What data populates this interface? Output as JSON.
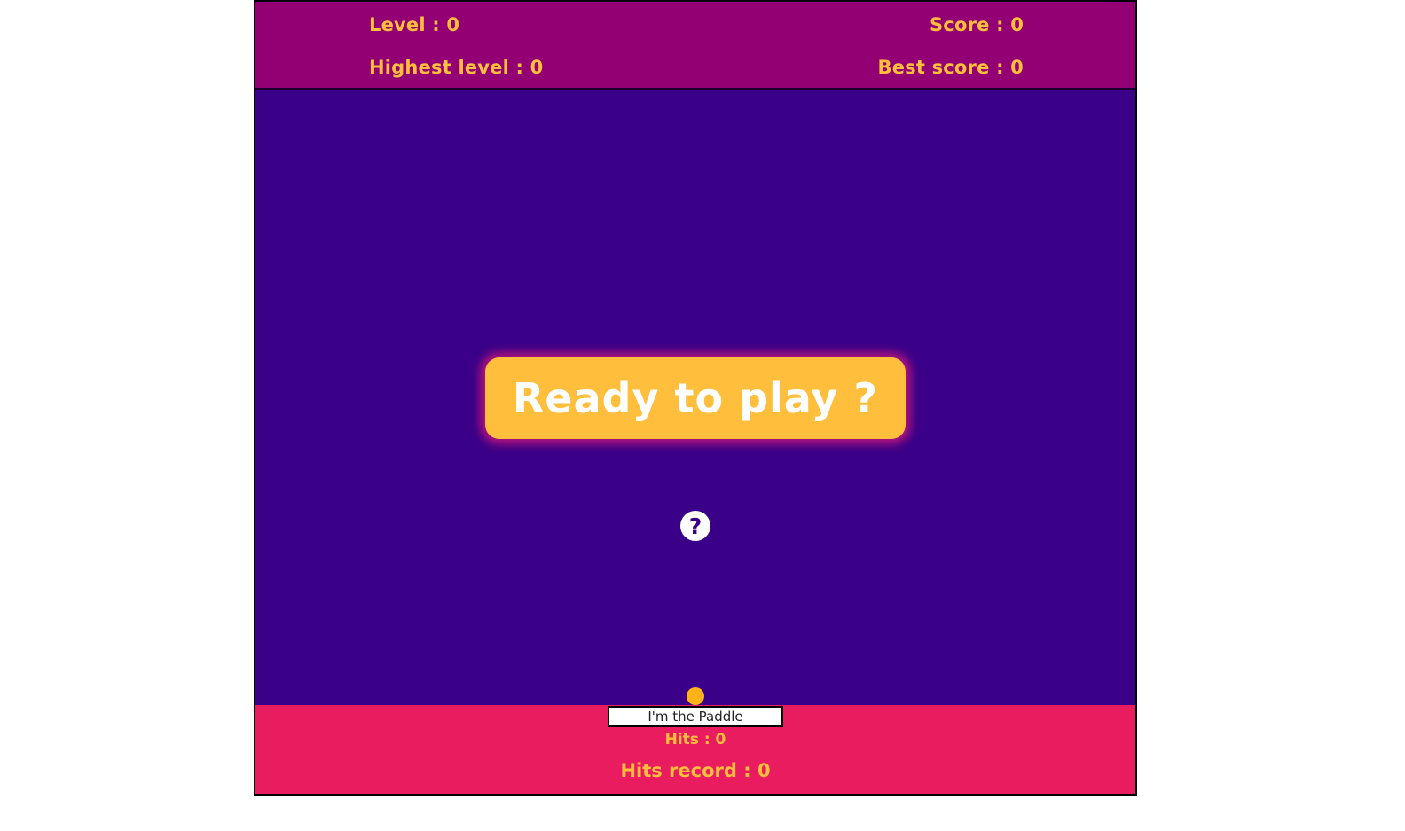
{
  "header": {
    "level": "Level : 0",
    "highest_level": "Highest level : 0",
    "score": "Score : 0",
    "best_score": "Best score : 0"
  },
  "main": {
    "ready_label": "Ready to play ?",
    "help_label": "?"
  },
  "footer": {
    "paddle_label": "I'm the Paddle",
    "hits": "Hits : 0",
    "hits_record": "Hits record : 0"
  },
  "colors": {
    "header_bg": "#930073",
    "play_bg": "#3a0088",
    "footer_bg": "#e81c5f",
    "accent": "#ffbe3b",
    "ball": "#ffb319"
  }
}
